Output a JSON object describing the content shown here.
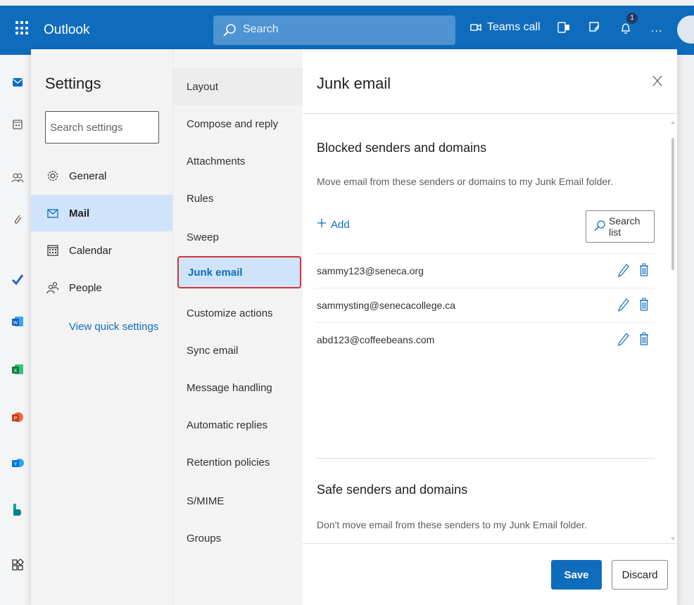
{
  "topbar": {
    "app_name": "Outlook",
    "search_placeholder": "Search",
    "teams_call_label": "Teams call",
    "notification_count": "1",
    "more_label": "...",
    "bg_color": "#0f6cbd"
  },
  "rail": {
    "icons": [
      "mail-icon",
      "calendar-icon",
      "people-icon",
      "attachment-icon",
      "todo-icon",
      "word-icon",
      "excel-icon",
      "powerpoint-icon",
      "yammer-icon",
      "bookings-icon",
      "apps-icon"
    ]
  },
  "settings": {
    "title": "Settings",
    "search_placeholder": "Search settings",
    "categories": [
      {
        "label": "General",
        "icon": "gear-icon"
      },
      {
        "label": "Mail",
        "icon": "mail-icon"
      },
      {
        "label": "Calendar",
        "icon": "calendar-icon"
      },
      {
        "label": "People",
        "icon": "people-icon"
      }
    ],
    "view_quick_settings": "View quick settings"
  },
  "mail_nav": {
    "items": [
      "Layout",
      "Compose and reply",
      "Attachments",
      "Rules",
      "Sweep",
      "Junk email",
      "Customize actions",
      "Sync email",
      "Message handling",
      "Automatic replies",
      "Retention policies",
      "S/MIME",
      "Groups"
    ]
  },
  "junk": {
    "title": "Junk email",
    "close_label": "X",
    "blocked": {
      "title": "Blocked senders and domains",
      "description": "Move email from these senders or domains to my Junk Email folder.",
      "add_label": "Add",
      "search_list_label": "Search list",
      "entries": [
        "sammy123@seneca.org",
        "sammysting@senecacollege.ca",
        "abd123@coffeebeans.com"
      ]
    },
    "safe": {
      "title": "Safe senders and domains",
      "description": "Don't move email from these senders to my Junk Email folder."
    },
    "save_label": "Save",
    "discard_label": "Discard"
  },
  "colors": {
    "accent": "#0f6cbd",
    "selection": "#cfe4fa",
    "highlight_border": "#d13438"
  }
}
